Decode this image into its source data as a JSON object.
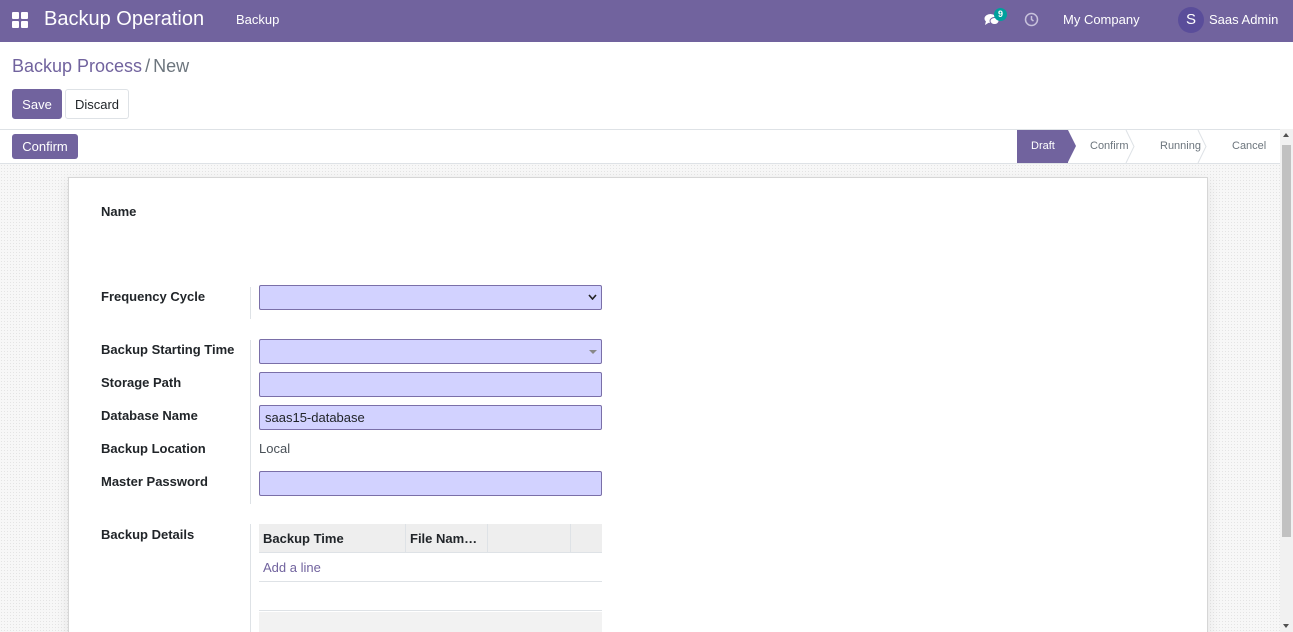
{
  "navbar": {
    "app_title": "Backup Operation",
    "menu_item": "Backup",
    "messages_count": "9",
    "company": "My Company",
    "avatar_letter": "S",
    "user_name": "Saas Admin",
    "icons": [
      "apps-grid-icon",
      "chat-icon",
      "clock-icon"
    ]
  },
  "breadcrumb": {
    "parent": "Backup Process",
    "separator": "/",
    "current": "New"
  },
  "actions": {
    "save_label": "Save",
    "discard_label": "Discard"
  },
  "statusbar": {
    "confirm_button": "Confirm",
    "stages": [
      {
        "label": "Draft",
        "active": true
      },
      {
        "label": "Confirm",
        "active": false
      },
      {
        "label": "Running",
        "active": false
      },
      {
        "label": "Cancel",
        "active": false
      }
    ]
  },
  "form": {
    "name_label": "Name",
    "name_value": "",
    "frequency_cycle_label": "Frequency Cycle",
    "frequency_cycle_value": "",
    "backup_starting_time_label": "Backup Starting Time",
    "backup_starting_time_value": "",
    "storage_path_label": "Storage Path",
    "storage_path_value": "",
    "database_name_label": "Database Name",
    "database_name_value": "saas15-database",
    "backup_location_label": "Backup Location",
    "backup_location_value": "Local",
    "master_password_label": "Master Password",
    "master_password_value": "",
    "backup_details_label": "Backup Details",
    "backup_details_columns": [
      "Backup Time",
      "File Nam…",
      "",
      ""
    ],
    "add_line_label": "Add a line"
  },
  "colors": {
    "brand": "#71639e",
    "required_field_bg": "#d2d2ff",
    "badge": "#00a09d"
  }
}
